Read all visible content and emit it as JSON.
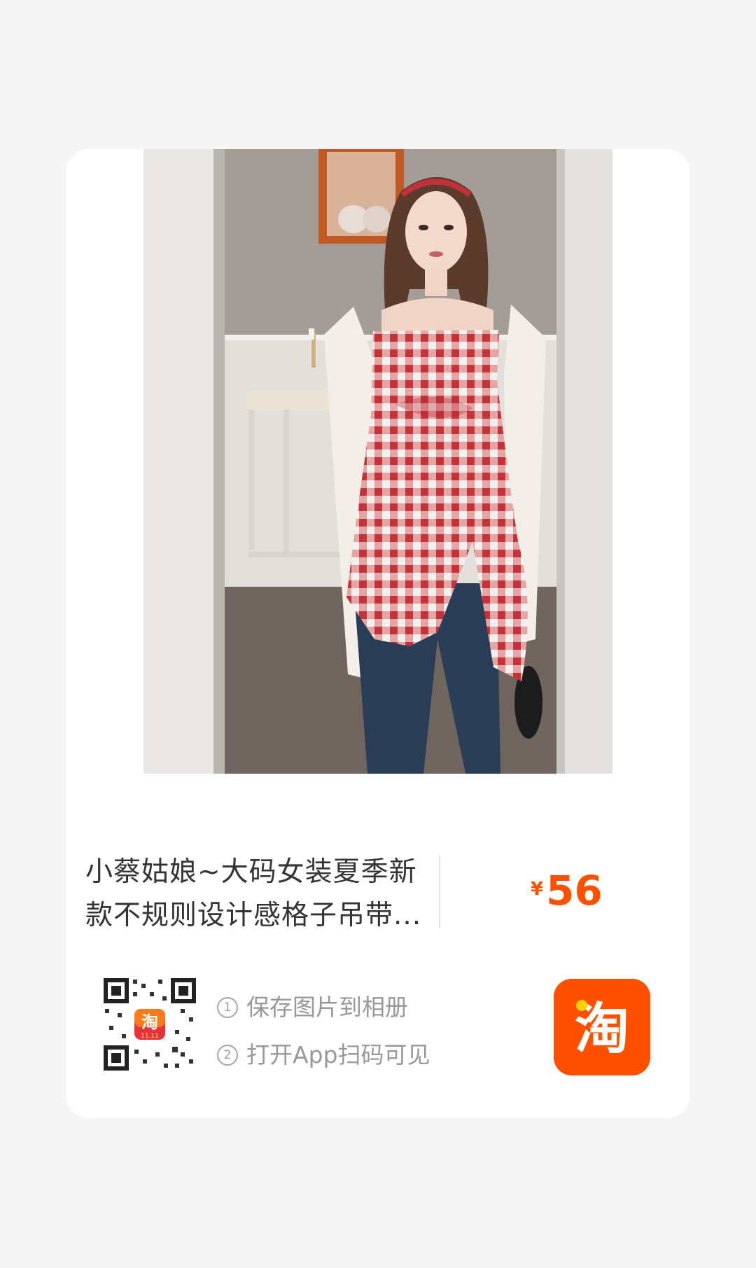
{
  "product": {
    "image_alt": "商品图片",
    "title_line1": "小蔡姑娘~大码女装夏季新",
    "title_line2": "款不规则设计感格子吊带...",
    "price_symbol": "¥",
    "price_value": "56"
  },
  "share": {
    "step1_num": "①",
    "step1_text": "保存图片到相册",
    "step2_num": "②",
    "step2_text": "打开App扫码可见",
    "qr_badge_text": "11.11",
    "app_icon_glyph": "淘"
  },
  "colors": {
    "accent": "#ff5000",
    "title": "#333333",
    "secondary": "#999999",
    "background": "#f5f5f5",
    "card": "#ffffff"
  },
  "icons": [
    "qr-code-icon",
    "taobao-app-icon"
  ]
}
